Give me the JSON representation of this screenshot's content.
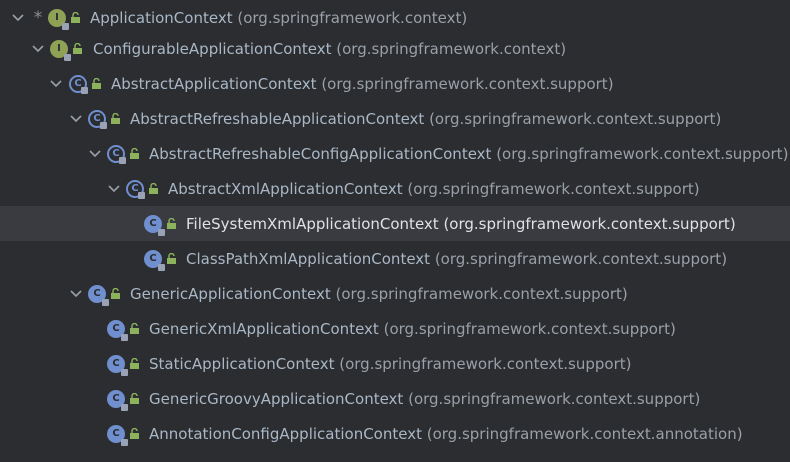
{
  "hierarchy": {
    "rows": [
      {
        "name": "ApplicationContext",
        "pkg": "(org.springframework.context)"
      },
      {
        "name": "ConfigurableApplicationContext",
        "pkg": "(org.springframework.context)"
      },
      {
        "name": "AbstractApplicationContext",
        "pkg": "(org.springframework.context.support)"
      },
      {
        "name": "AbstractRefreshableApplicationContext",
        "pkg": "(org.springframework.context.support)"
      },
      {
        "name": "AbstractRefreshableConfigApplicationContext",
        "pkg": "(org.springframework.context.support)"
      },
      {
        "name": "AbstractXmlApplicationContext",
        "pkg": "(org.springframework.context.support)"
      },
      {
        "name": "FileSystemXmlApplicationContext",
        "pkg": "(org.springframework.context.support)"
      },
      {
        "name": "ClassPathXmlApplicationContext",
        "pkg": "(org.springframework.context.support)"
      },
      {
        "name": "GenericApplicationContext",
        "pkg": "(org.springframework.context.support)"
      },
      {
        "name": "GenericXmlApplicationContext",
        "pkg": "(org.springframework.context.support)"
      },
      {
        "name": "StaticApplicationContext",
        "pkg": "(org.springframework.context.support)"
      },
      {
        "name": "GenericGroovyApplicationContext",
        "pkg": "(org.springframework.context.support)"
      },
      {
        "name": "AnnotationConfigApplicationContext",
        "pkg": "(org.springframework.context.annotation)"
      }
    ],
    "icons": {
      "interface_letter": "I",
      "class_letter": "C"
    },
    "marker": "*",
    "colors": {
      "background": "#2b2d30",
      "selected_row": "#393b40",
      "interface_icon": "#8ea155",
      "class_icon": "#6f8fcf",
      "public_lock": "#8cb35c"
    }
  }
}
